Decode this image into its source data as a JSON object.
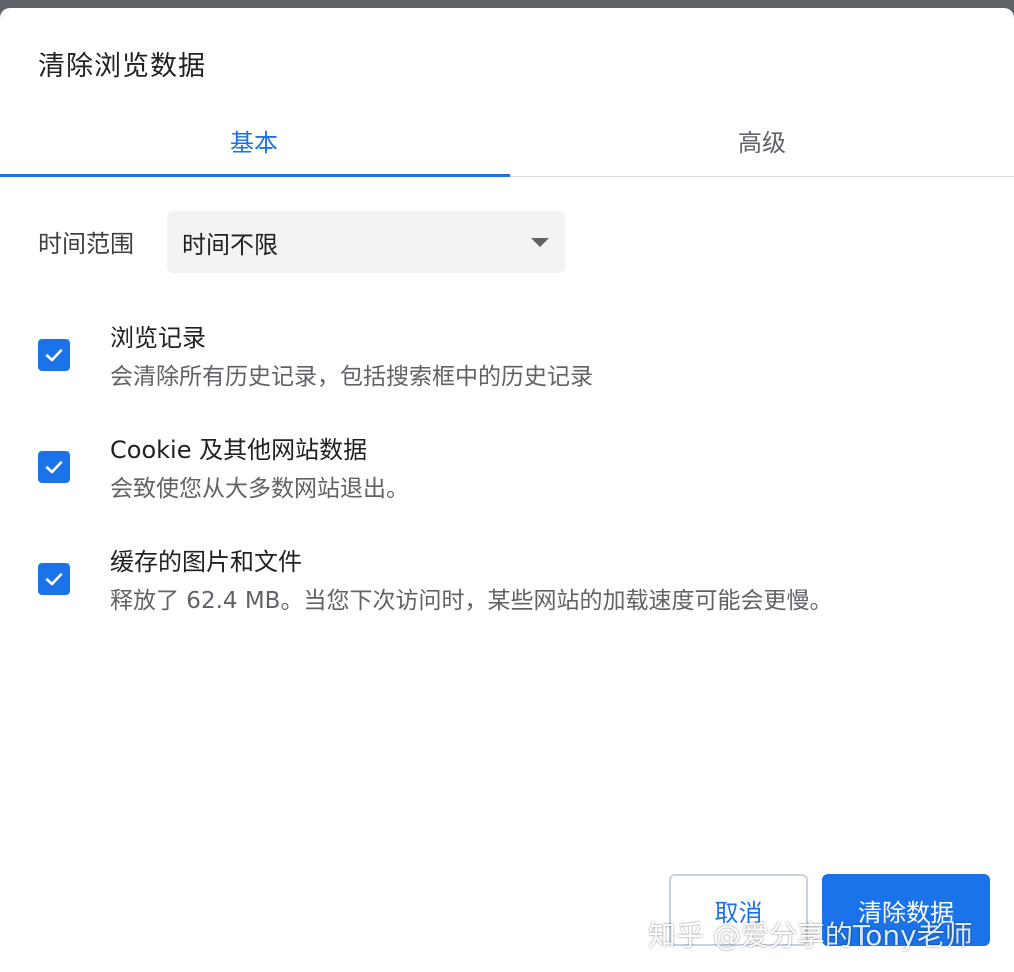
{
  "dialog": {
    "title": "清除浏览数据"
  },
  "tabs": [
    {
      "label": "基本",
      "active": true
    },
    {
      "label": "高级",
      "active": false
    }
  ],
  "time_range": {
    "label": "时间范围",
    "selected": "时间不限"
  },
  "items": [
    {
      "title": "浏览记录",
      "description": "会清除所有历史记录，包括搜索框中的历史记录",
      "checked": true
    },
    {
      "title": "Cookie 及其他网站数据",
      "description": "会致使您从大多数网站退出。",
      "checked": true
    },
    {
      "title": "缓存的图片和文件",
      "description": "释放了 62.4 MB。当您下次访问时，某些网站的加载速度可能会更慢。",
      "checked": true
    }
  ],
  "buttons": {
    "cancel": "取消",
    "clear": "清除数据"
  },
  "watermark": "知乎 @爱分享的Tony老师",
  "colors": {
    "accent": "#1a73e8",
    "backdrop": "#5f6368",
    "select_bg": "#f1f3f4"
  },
  "icons": {
    "checkbox": "check-icon",
    "dropdown": "caret-down-icon"
  }
}
